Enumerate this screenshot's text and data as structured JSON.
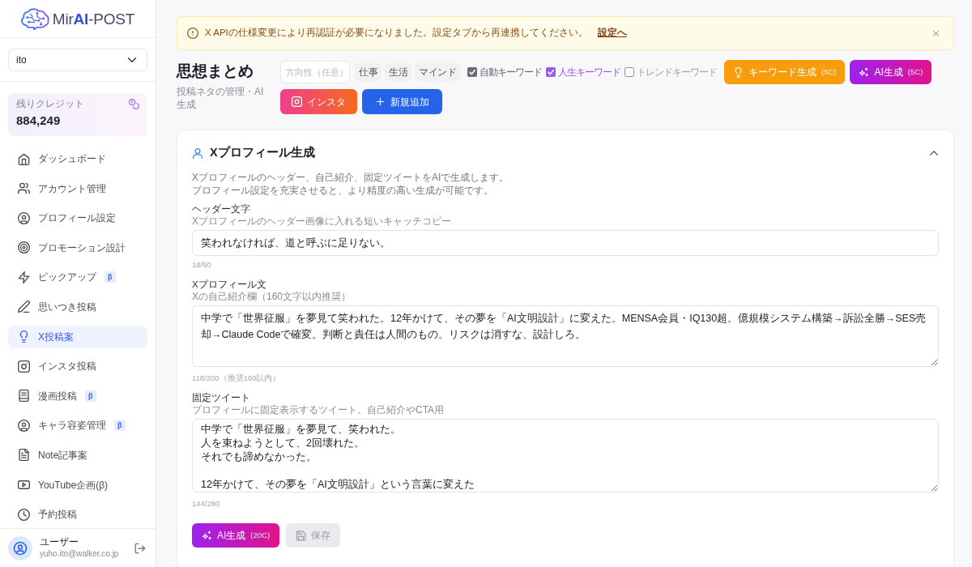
{
  "logo": {
    "text": "Mir**AI**-POST"
  },
  "account_select": {
    "value": "ito"
  },
  "credits": {
    "label": "残りクレジット",
    "value": "884,249"
  },
  "sidebar": {
    "items": [
      {
        "label": "ダッシュボード",
        "selected": false
      },
      {
        "label": "アカウント管理",
        "selected": false
      },
      {
        "label": "プロフィール設定",
        "selected": false
      },
      {
        "label": "プロモーション設計",
        "selected": false
      },
      {
        "label": "ピックアップ",
        "selected": false,
        "badge": "β"
      },
      {
        "label": "思いつき投稿",
        "selected": false
      },
      {
        "label": "X投稿案",
        "selected": true
      },
      {
        "label": "インスタ投稿",
        "selected": false
      },
      {
        "label": "漫画投稿",
        "selected": false,
        "badge": "β"
      },
      {
        "label": "キャラ容姿管理",
        "selected": false,
        "badge": "β"
      },
      {
        "label": "Note記事案",
        "selected": false
      },
      {
        "label": "YouTube企画(β)",
        "selected": false
      },
      {
        "label": "予約投稿",
        "selected": false
      }
    ]
  },
  "user": {
    "name": "ユーザー",
    "email": "yuho.ito@walker.co.jp"
  },
  "alert": {
    "message": "X APIの仕様変更により再認証が必要になりました。設定タブから再連携してください。",
    "link": "設定へ"
  },
  "header": {
    "title": "思想まとめ",
    "subtitle": "投稿ネタの管理・AI生成"
  },
  "toolbar": {
    "direction_field": {
      "placeholder": "方向性（任意）"
    },
    "chips": [
      {
        "label": "仕事",
        "selected": false
      },
      {
        "label": "生活",
        "selected": false
      },
      {
        "label": "マインド",
        "selected": false
      }
    ],
    "checkboxes": [
      {
        "label": "自動キーワード",
        "checked": true,
        "color": "#6b6b72"
      },
      {
        "label": "人生キーワード",
        "checked": true,
        "color": "#9b5de5"
      },
      {
        "label": "トレンドキーワード",
        "checked": false
      }
    ],
    "buttons": [
      {
        "kind": "keyword",
        "label": "キーワード生成",
        "cost": "(5C)"
      },
      {
        "kind": "ai",
        "label": "AI生成",
        "cost": "(5C)"
      },
      {
        "kind": "instagram",
        "label": "インスタ"
      },
      {
        "kind": "add",
        "label": "新規追加"
      }
    ]
  },
  "card": {
    "title": "Xプロフィール生成",
    "expanded": true,
    "description": [
      "Xプロフィールのヘッダー、自己紹介、固定ツイートをAIで生成します。",
      "プロフィール設定を充実させると、より精度の高い生成が可能です。"
    ],
    "fields": [
      {
        "kind": "input",
        "label": "ヘッダー文字",
        "hint": "Xプロフィールのヘッダー画像に入れる短いキャッチコピー",
        "value": "笑われなければ、道と呼ぶに足りない。",
        "counter": "18/50"
      },
      {
        "kind": "textarea",
        "label": "Xプロフィール文",
        "hint": "Xの自己紹介欄（160文字以内推奨）",
        "value": "中学で「世界征服」を夢見て笑われた。12年かけて、その夢を「AI文明設計」に変えた。MENSA会員・IQ130超。億規模システム構築→訴訟全勝→SES売却→Claude Codeで確変。判断と責任は人間のもの。リスクは消すな、設計しろ。",
        "counter": "118/200（推奨160以内）"
      },
      {
        "kind": "multiline",
        "label": "固定ツイート",
        "hint": "プロフィールに固定表示するツイート。自己紹介やCTA用",
        "paragraphs": [
          [
            "中学で「世界征服」を夢見て、笑われた。",
            "人を束ねようとして、2回壊れた。",
            "それでも諦めなかった。"
          ],
          [
            "12年かけて、その夢を「AI文明設計」という言葉に変えた"
          ]
        ],
        "counter": "144/280"
      }
    ],
    "actions": [
      {
        "kind": "ai",
        "label": "AI生成",
        "cost": "(20C)",
        "disabled": false
      },
      {
        "kind": "save",
        "label": "保存",
        "disabled": true
      }
    ]
  }
}
